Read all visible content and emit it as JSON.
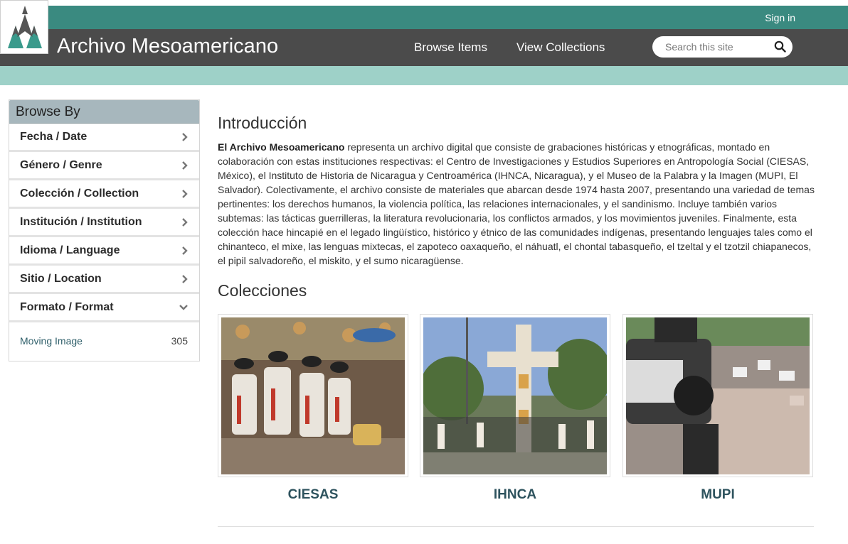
{
  "header": {
    "site_title": "Archivo Mesoamericano",
    "signin_label": "Sign in",
    "nav": [
      {
        "label": "Browse Items"
      },
      {
        "label": "View Collections"
      }
    ],
    "search": {
      "placeholder": "Search this site"
    }
  },
  "sidebar": {
    "title": "Browse By",
    "items": [
      {
        "label": "Fecha / Date",
        "icon": "chevron-right-icon"
      },
      {
        "label": "Género / Genre",
        "icon": "chevron-right-icon"
      },
      {
        "label": "Colección / Collection",
        "icon": "chevron-right-icon"
      },
      {
        "label": "Institución / Institution",
        "icon": "chevron-right-icon"
      },
      {
        "label": "Idioma / Language",
        "icon": "chevron-right-icon"
      },
      {
        "label": "Sitio / Location",
        "icon": "chevron-right-icon"
      },
      {
        "label": "Formato / Format",
        "icon": "chevron-down-icon"
      }
    ],
    "expanded": {
      "label": "Moving Image",
      "count": "305"
    }
  },
  "main": {
    "intro_heading": "Introducción",
    "intro_lead": "El Archivo Mesoamericano",
    "intro_body": " representa un archivo digital que consiste de grabaciones históricas y etnográficas, montado en colaboración con estas instituciones respectivas: el Centro de Investigaciones y Estudios Superiores en Antropología Social (CIESAS, México), el Instituto de Historia de Nicaragua y Centroamérica (IHNCA, Nicaragua), y el Museo de la Palabra y la Imagen (MUPI, El Salvador). Colectivamente, el archivo consiste de materiales que abarcan desde 1974 hasta 2007, presentando una variedad de temas pertinentes: los derechos humanos, la violencia política, las relaciones internacionales, y el sandinismo. Incluye también varios subtemas: las tácticas guerrilleras, la literatura revolucionaria, los conflictos armados, y los movimientos juveniles. Finalmente, esta colección hace hincapié en el legado lingüístico, histórico y étnico de las comunidades indígenas, presentando lenguajes tales como el chinanteco, el mixe, las lenguas mixtecas, el zapoteco oaxaqueño, el náhuatl, el chontal tabasqueño, el tzeltal y el tzotzil chiapanecos, el pipil salvadoreño, el miskito, y el sumo nicaragüense.",
    "collections_heading": "Colecciones",
    "collections": [
      {
        "label": "CIESAS"
      },
      {
        "label": "IHNCA"
      },
      {
        "label": "MUPI"
      }
    ]
  },
  "colors": {
    "teal_bar": "#3a8a80",
    "dark_bar": "#4b4b4b",
    "light_bar": "#9ed1c8",
    "link": "#2e535e"
  }
}
